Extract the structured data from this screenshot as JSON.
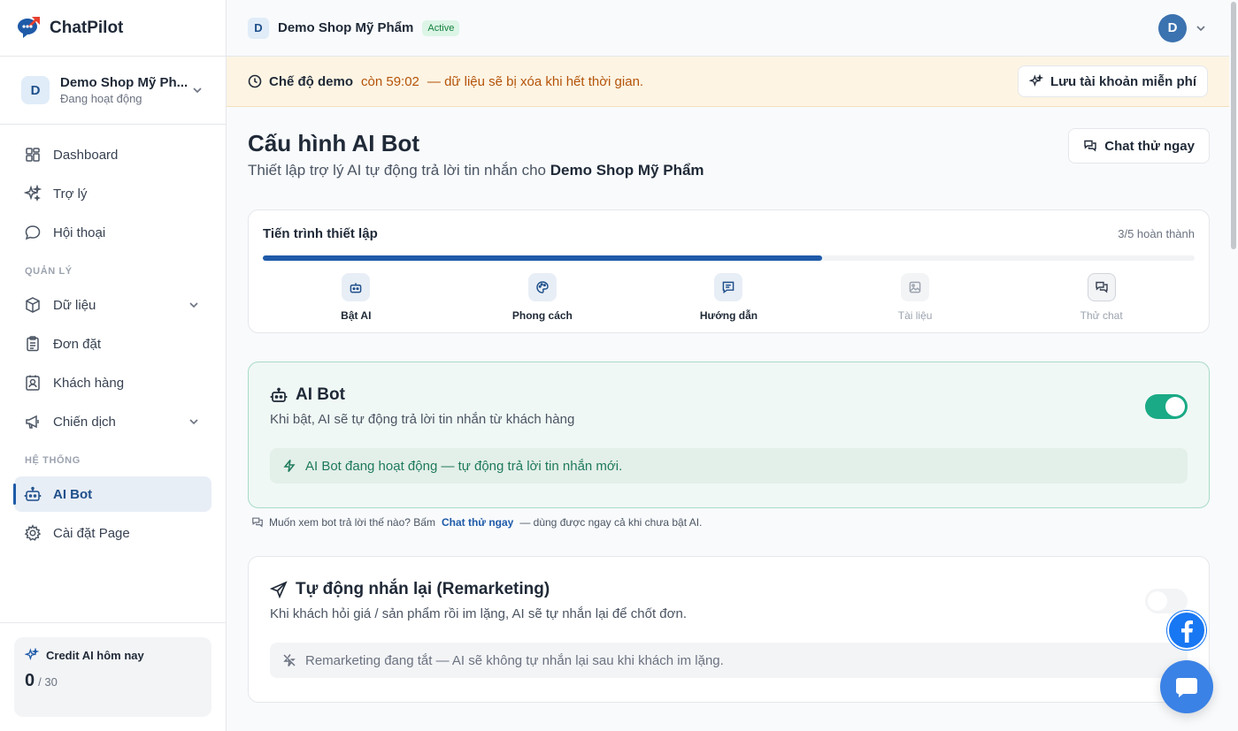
{
  "brand": {
    "name": "ChatPilot"
  },
  "shop_switcher": {
    "avatar": "D",
    "name": "Demo Shop Mỹ Ph...",
    "status": "Đang hoạt động"
  },
  "nav": {
    "items": [
      {
        "label": "Dashboard",
        "icon": "grid-icon"
      },
      {
        "label": "Trợ lý",
        "icon": "sparkles-icon"
      },
      {
        "label": "Hội thoại",
        "icon": "chat-bubble-icon"
      }
    ],
    "section_manage": "QUẢN LÝ",
    "manage_items": [
      {
        "label": "Dữ liệu",
        "icon": "cube-icon"
      },
      {
        "label": "Đơn đặt",
        "icon": "clipboard-icon"
      },
      {
        "label": "Khách hàng",
        "icon": "contact-icon"
      },
      {
        "label": "Chiến dịch",
        "icon": "megaphone-icon"
      }
    ],
    "section_system": "HỆ THỐNG",
    "system_items": [
      {
        "label": "AI Bot",
        "icon": "bot-icon",
        "active": true
      },
      {
        "label": "Cài đặt Page",
        "icon": "gear-icon"
      }
    ]
  },
  "credit": {
    "title": "Credit AI hôm nay",
    "used": "0",
    "total": "/ 30"
  },
  "topbar": {
    "avatar": "D",
    "shop_name": "Demo Shop Mỹ Phẩm",
    "badge": "Active",
    "user_avatar": "D"
  },
  "banner": {
    "mode": "Chế độ demo",
    "time": "còn 59:02",
    "message": "— dữ liệu sẽ bị xóa khi hết thời gian.",
    "save_button": "Lưu tài khoản miễn phí"
  },
  "page": {
    "title": "Cấu hình AI Bot",
    "subtitle_prefix": "Thiết lập trợ lý AI tự động trả lời tin nhắn cho",
    "subtitle_shop": "Demo Shop Mỹ Phẩm",
    "chat_test_button": "Chat thử ngay"
  },
  "progress": {
    "title": "Tiến trình thiết lập",
    "count": "3/5 hoàn thành",
    "fraction": 0.6,
    "steps": [
      {
        "label": "Bật AI",
        "icon": "bot-icon"
      },
      {
        "label": "Phong cách",
        "icon": "palette-icon"
      },
      {
        "label": "Hướng dẫn",
        "icon": "message-lines-icon"
      },
      {
        "label": "Tài liệu",
        "icon": "image-icon"
      },
      {
        "label": "Thử chat",
        "icon": "chats-icon"
      }
    ]
  },
  "ai_bot": {
    "title": "AI Bot",
    "description": "Khi bật, AI sẽ tự động trả lời tin nhắn từ khách hàng",
    "enabled": true,
    "status": "AI Bot đang hoạt động — tự động trả lời tin nhắn mới."
  },
  "hint": {
    "prefix": "Muốn xem bot trả lời thế nào? Bấm",
    "link": "Chat thử ngay",
    "suffix": "— dùng được ngay cả khi chưa bật AI."
  },
  "remarketing": {
    "title": "Tự động nhắn lại (Remarketing)",
    "description": "Khi khách hỏi giá / sản phẩm rồi im lặng, AI sẽ tự nhắn lại để chốt đơn.",
    "enabled": false,
    "status": "Remarketing đang tắt — AI sẽ không tự nhắn lại sau khi khách im lặng."
  },
  "colors": {
    "primary": "#1e5aa8",
    "success": "#1aaa85",
    "warning_bg": "#fdf4e3",
    "facebook": "#1877f2"
  }
}
